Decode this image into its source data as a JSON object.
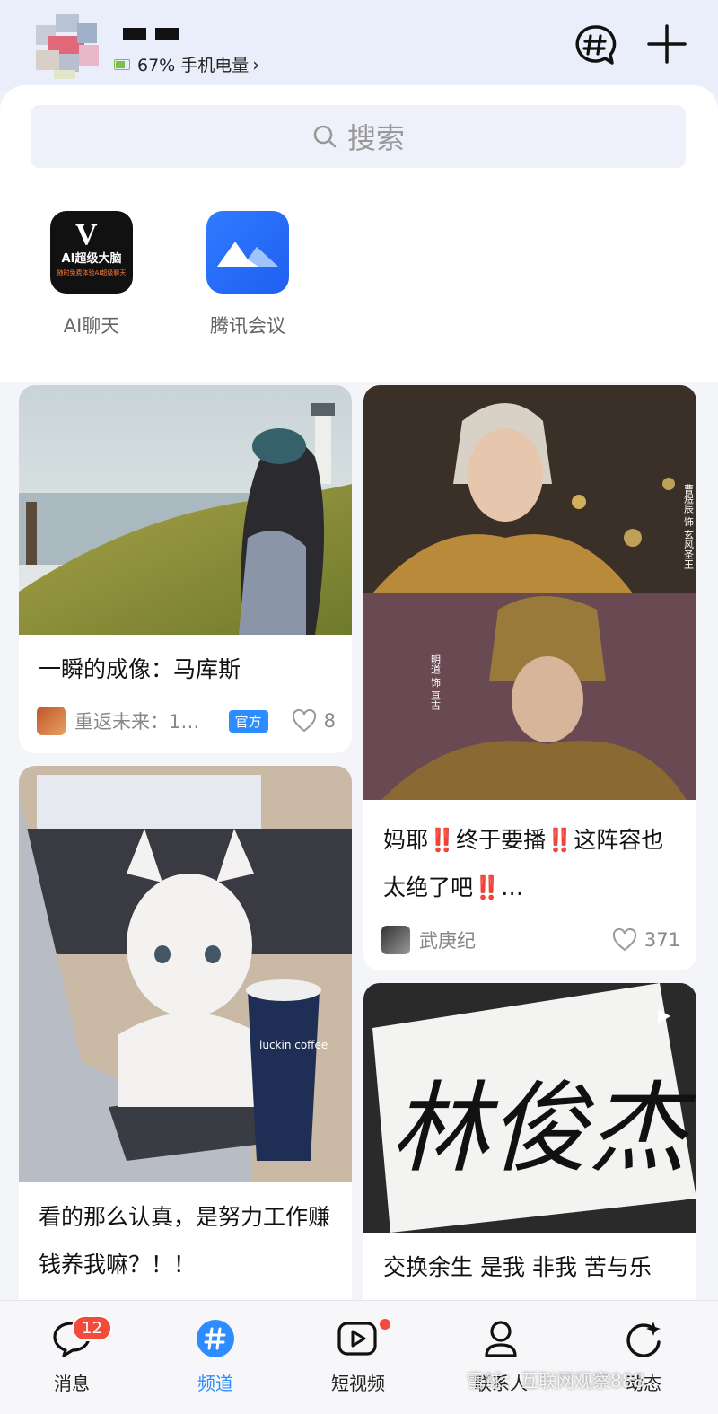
{
  "header": {
    "battery_text": "67% 手机电量",
    "chevron": "›",
    "icons": [
      "hashtag-chat-icon",
      "plus-icon"
    ]
  },
  "search": {
    "placeholder": "搜索",
    "icon": "search-icon"
  },
  "apps": [
    {
      "label": "AI聊天",
      "tile_title": "AI超级大脑",
      "tile_sub": "随时免费体验AI超级聊天",
      "tile_mark": "V"
    },
    {
      "label": "腾讯会议"
    }
  ],
  "feed": {
    "cards": [
      {
        "title": "一瞬的成像：马库斯",
        "author": "重返未来：1…",
        "badge": "官方",
        "likes": "8"
      },
      {
        "title": "妈耶‼️终于要播‼️这阵容也太绝了吧‼️…",
        "author": "武庚纪",
        "likes": "371",
        "poster_text_1": "曹煜辰 饰 玄风圣王",
        "poster_text_2": "明道 饰 亘古"
      },
      {
        "title": "看的那么认真，是努力工作赚钱养我嘛？！！",
        "cup_text": "luckin coffee"
      },
      {
        "title": "交换余生 是我 非我 苦与乐",
        "calligraphy": "林俊杰"
      }
    ]
  },
  "tabbar": {
    "tabs": [
      {
        "label": "消息",
        "badge": "12"
      },
      {
        "label": "频道"
      },
      {
        "label": "短视频"
      },
      {
        "label": "联系人"
      },
      {
        "label": "动态"
      }
    ],
    "active": "频道"
  },
  "watermark": "雪球：互联网观察888",
  "colors": {
    "accent": "#2d8cff",
    "badge_red": "#f24b3c",
    "header_bg": "#eaeefb"
  }
}
